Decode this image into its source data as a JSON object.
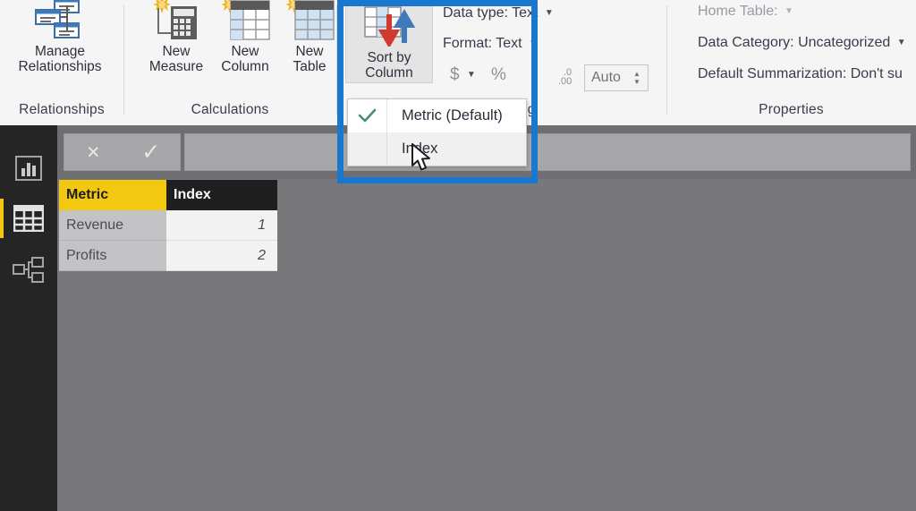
{
  "app": {
    "name": "Power BI Desktop",
    "accent_yellow": "#F2C811",
    "annotation_blue": "#1878D0",
    "canvas_gray": "#787779"
  },
  "ribbon": {
    "groups": [
      {
        "label": "Relationships"
      },
      {
        "label": "Calculations"
      },
      {
        "label": "Formatting"
      },
      {
        "label": "Properties"
      }
    ],
    "buttons": [
      {
        "name": "manage-relationships",
        "label": "Manage\nRelationships",
        "icon": "relationships-icon"
      },
      {
        "name": "new-measure",
        "label": "New\nMeasure",
        "icon": "new-measure-icon"
      },
      {
        "name": "new-column",
        "label": "New\nColumn",
        "icon": "new-column-icon"
      },
      {
        "name": "new-table",
        "label": "New\nTable",
        "icon": "new-table-icon"
      },
      {
        "name": "sort-by-column",
        "label": "Sort by\nColumn",
        "icon": "sort-by-column-icon"
      }
    ],
    "formatting": {
      "data_type_label": "Data type:",
      "data_type_value": "Text",
      "format_label": "Format:",
      "format_value": "Text",
      "currency_symbol": "$",
      "percent_symbol": "%",
      "decimal_icon_label": ".00",
      "auto_value": "Auto"
    },
    "properties": {
      "home_table_label": "Home Table:",
      "home_table_value": "",
      "data_category_label": "Data Category:",
      "data_category_value": "Uncategorized",
      "default_summarization_label": "Default Summarization:",
      "default_summarization_value": "Don't su"
    }
  },
  "sort_menu": {
    "items": [
      {
        "label": "Metric (Default)",
        "checked": true,
        "hovered": false
      },
      {
        "label": "Index",
        "checked": false,
        "hovered": true
      }
    ]
  },
  "rail": {
    "items": [
      {
        "name": "report-view",
        "icon": "bar-chart-icon",
        "active": false
      },
      {
        "name": "data-view",
        "icon": "table-grid-icon",
        "active": true
      },
      {
        "name": "model-view",
        "icon": "relationship-model-icon",
        "active": false
      }
    ]
  },
  "formula_bar": {
    "cancel_glyph": "×",
    "accept_glyph": "✓",
    "value": "",
    "placeholder": ""
  },
  "data_grid": {
    "columns": [
      "Metric",
      "Index"
    ],
    "rows": [
      {
        "metric": "Revenue",
        "index": "1"
      },
      {
        "metric": "Profits",
        "index": "2"
      }
    ]
  }
}
